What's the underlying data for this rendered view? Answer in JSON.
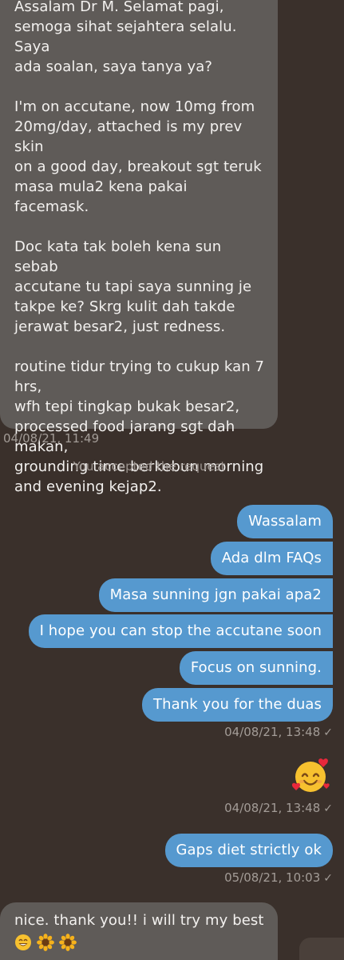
{
  "messages": {
    "m1": {
      "paragraphs": [
        [
          "Assalam Dr M. Selamat pagi,",
          "semoga sihat sejahtera selalu. Saya",
          "ada soalan, saya tanya ya?"
        ],
        [
          "I'm on accutane, now 10mg from",
          "20mg/day, attached is my prev skin",
          "on a good day, breakout sgt teruk",
          "masa mula2 kena pakai facemask."
        ],
        [
          "Doc kata tak boleh kena sun sebab",
          "accutane tu tapi saya sunning je",
          "takpe ke? Skrg kulit dah takde",
          "jerawat besar2, just redness."
        ],
        [
          "routine tidur trying to cukup kan 7",
          "hrs,",
          "wfh tepi tingkap bukak besar2,",
          "processed food jarang sgt dah",
          "makan,",
          "grounding time berkebun morning",
          "and evening kejap2."
        ]
      ],
      "timestamp": "04/08/21, 11:49"
    },
    "system_notice": "You accepted the request",
    "outgoing_group1": {
      "items": [
        "Wassalam",
        "Ada dlm FAQs",
        "Masa sunning jgn pakai apa2",
        "I hope you can stop the accutane soon",
        "Focus on sunning.",
        "Thank you for the duas"
      ],
      "timestamp": "04/08/21, 13:48"
    },
    "emoji_message": {
      "emoji": "smiling-face-with-hearts",
      "timestamp": "04/08/21, 13:48"
    },
    "gaps_message": {
      "text": "Gaps diet strictly ok",
      "timestamp": "05/08/21, 10:03"
    },
    "last_incoming": {
      "line1": "nice. thank you!! i will try my best",
      "emojis": [
        "grinning-face-icon",
        "sunflower-icon",
        "sunflower-icon"
      ]
    }
  },
  "colors": {
    "background": "#3a302b",
    "incoming_bubble": "#5f5b58",
    "outgoing_bubble": "#5699cf",
    "meta_text": "#a39c97"
  },
  "read_mark": "✓"
}
